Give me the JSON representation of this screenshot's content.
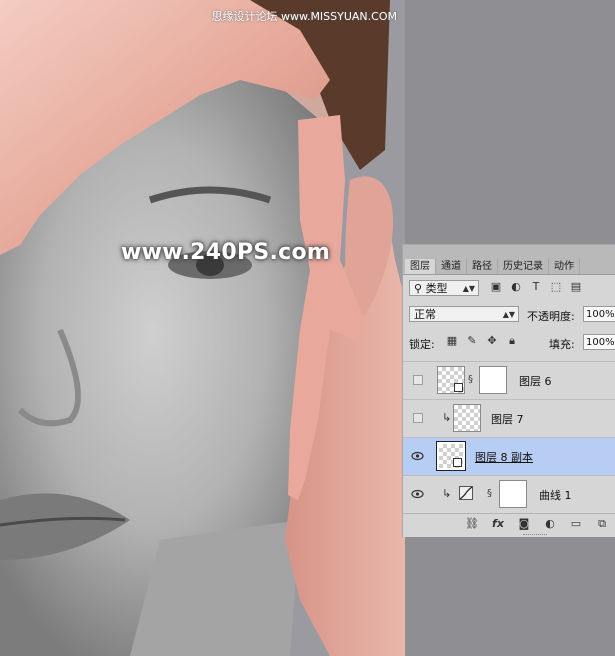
{
  "watermark": {
    "top_right": "思缘设计论坛 www.MISSYUAN.COM",
    "site": "www.240PS.com"
  },
  "tabs": [
    "图层",
    "通道",
    "路径",
    "历史记录",
    "动作"
  ],
  "filter": {
    "kind_label": "类型"
  },
  "blend": {
    "mode": "正常",
    "opacity_label": "不透明度:",
    "opacity_value": "100%"
  },
  "lock": {
    "label": "锁定:",
    "fill_label": "填充:",
    "fill_value": "100%"
  },
  "layers": [
    {
      "name": "图层 6",
      "visible": false,
      "mask": true,
      "clipped": false
    },
    {
      "name": "图层 7",
      "visible": false,
      "mask": false,
      "clipped": true
    },
    {
      "name": "图层 8 副本",
      "visible": true,
      "mask": false,
      "clipped": false,
      "selected": true
    },
    {
      "name": "曲线 1",
      "visible": true,
      "mask": true,
      "clipped": true,
      "adjustment": "curves"
    }
  ],
  "icons": [
    "eye-icon",
    "link-icon",
    "fx-icon",
    "mask-icon",
    "adjustment-icon",
    "folder-icon",
    "new-layer-icon",
    "trash-icon"
  ],
  "colors": {
    "selected_row": "#b8cdf3",
    "panel_bg": "#d6d6d6",
    "skin": "#e8a59a"
  }
}
